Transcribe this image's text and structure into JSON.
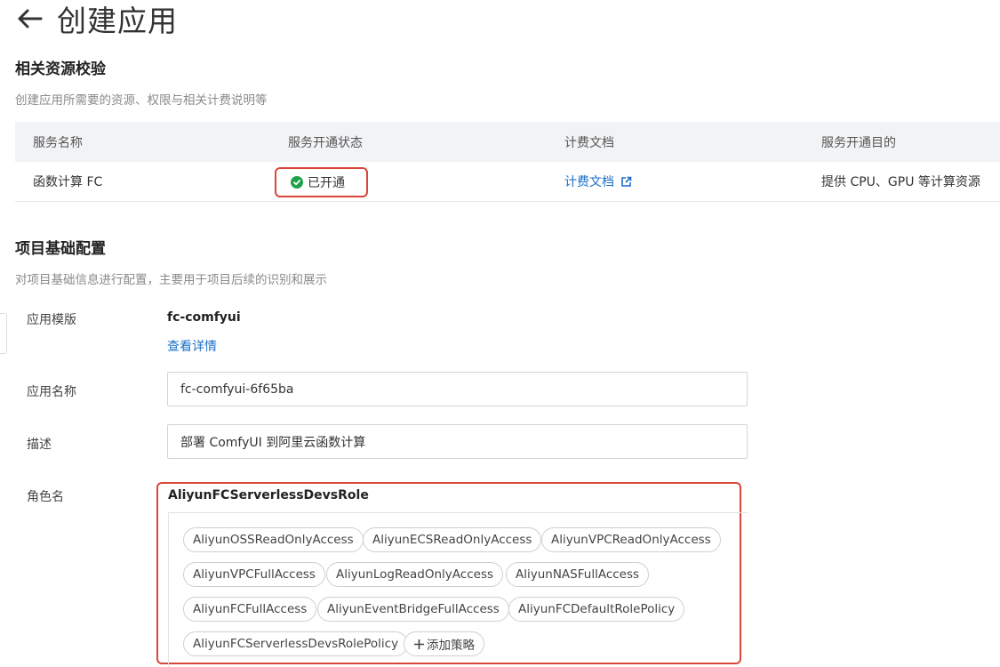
{
  "header": {
    "title": "创建应用"
  },
  "resource_check": {
    "title": "相关资源校验",
    "description": "创建应用所需要的资源、权限与相关计费说明等",
    "table": {
      "columns": [
        "服务名称",
        "服务开通状态",
        "计费文档",
        "服务开通目的"
      ],
      "rows": [
        {
          "service": "函数计算 FC",
          "status": "已开通",
          "doc_link": "计费文档",
          "purpose": "提供 CPU、GPU 等计算资源"
        }
      ]
    }
  },
  "project_config": {
    "title": "项目基础配置",
    "description": "对项目基础信息进行配置，主要用于项目后续的识别和展示",
    "template": {
      "label": "应用模版",
      "value": "fc-comfyui",
      "link": "查看详情"
    },
    "app_name": {
      "label": "应用名称",
      "value": "fc-comfyui-6f65ba"
    },
    "description_field": {
      "label": "描述",
      "value": "部署 ComfyUI 到阿里云函数计算"
    },
    "role": {
      "label": "角色名",
      "name": "AliyunFCServerlessDevsRole",
      "policies": [
        "AliyunOSSReadOnlyAccess",
        "AliyunECSReadOnlyAccess",
        "AliyunVPCReadOnlyAccess",
        "AliyunVPCFullAccess",
        "AliyunLogReadOnlyAccess",
        "AliyunNASFullAccess",
        "AliyunFCFullAccess",
        "AliyunEventBridgeFullAccess",
        "AliyunFCDefaultRolePolicy",
        "AliyunFCServerlessDevsRolePolicy"
      ],
      "add_policy": "添加策略"
    }
  },
  "colors": {
    "link": "#1b6fc7",
    "success": "#1fa04a",
    "highlight_border": "#d9463a",
    "table_header_bg": "#f2f3f5"
  },
  "icons": {
    "back": "arrow-left-icon",
    "status": "check-circle-icon",
    "external": "external-link-icon",
    "add": "plus-icon"
  }
}
